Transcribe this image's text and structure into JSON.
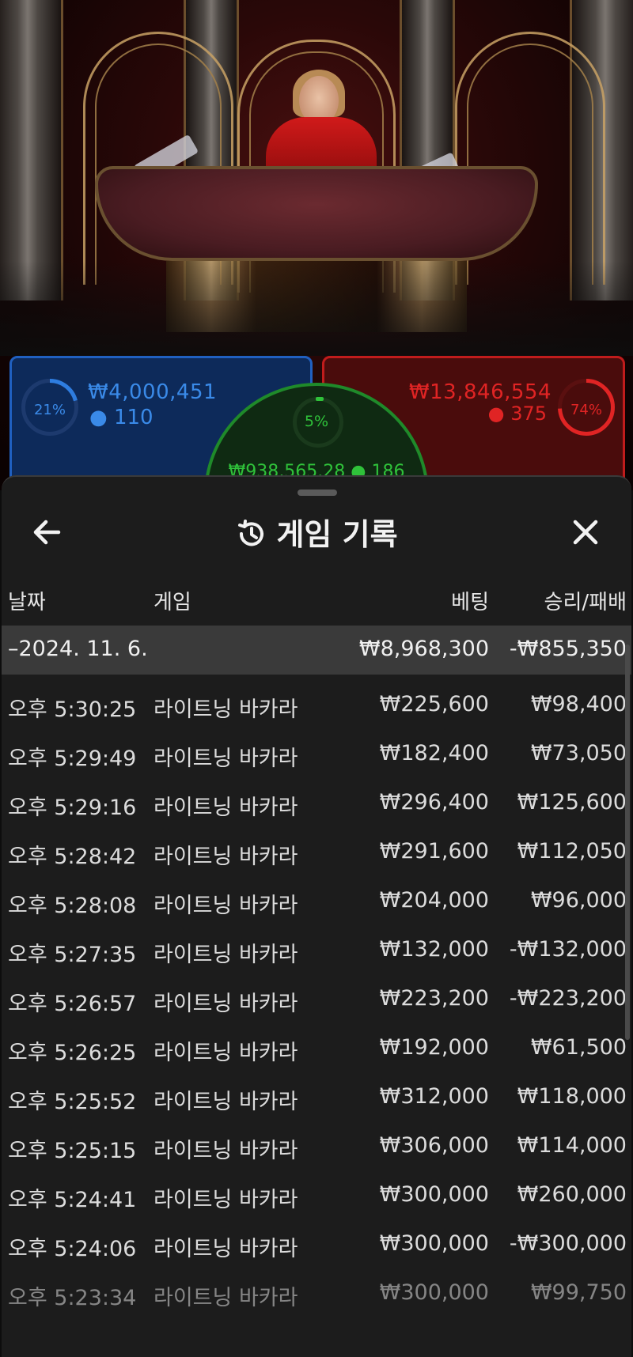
{
  "scene": {
    "player": {
      "percent": "21%",
      "amount": "₩4,000,451",
      "count": "110"
    },
    "banker": {
      "percent": "74%",
      "amount": "₩13,846,554",
      "count": "375"
    },
    "tie": {
      "percent": "5%",
      "amount": "₩938,565.28",
      "count": "186"
    },
    "colors": {
      "player": "#2060c0",
      "banker": "#c01c1c",
      "tie": "#2fc23a"
    }
  },
  "sheet": {
    "title": "게임 기록",
    "icons": {
      "back": "arrow-left-icon",
      "history": "history-icon",
      "close": "close-icon"
    },
    "columns": {
      "date": "날짜",
      "game": "게임",
      "bet": "베팅",
      "win_loss": "승리/패배"
    },
    "summary": {
      "date": "–2024. 11. 6.",
      "bet": "₩8,968,300",
      "win_loss": "-₩855,350"
    },
    "rows": [
      {
        "time": "오후 5:30:25",
        "game": "라이트닝 바카라",
        "bet": "₩225,600",
        "win_loss": "₩98,400"
      },
      {
        "time": "오후 5:29:49",
        "game": "라이트닝 바카라",
        "bet": "₩182,400",
        "win_loss": "₩73,050"
      },
      {
        "time": "오후 5:29:16",
        "game": "라이트닝 바카라",
        "bet": "₩296,400",
        "win_loss": "₩125,600"
      },
      {
        "time": "오후 5:28:42",
        "game": "라이트닝 바카라",
        "bet": "₩291,600",
        "win_loss": "₩112,050"
      },
      {
        "time": "오후 5:28:08",
        "game": "라이트닝 바카라",
        "bet": "₩204,000",
        "win_loss": "₩96,000"
      },
      {
        "time": "오후 5:27:35",
        "game": "라이트닝 바카라",
        "bet": "₩132,000",
        "win_loss": "-₩132,000"
      },
      {
        "time": "오후 5:26:57",
        "game": "라이트닝 바카라",
        "bet": "₩223,200",
        "win_loss": "-₩223,200"
      },
      {
        "time": "오후 5:26:25",
        "game": "라이트닝 바카라",
        "bet": "₩192,000",
        "win_loss": "₩61,500"
      },
      {
        "time": "오후 5:25:52",
        "game": "라이트닝 바카라",
        "bet": "₩312,000",
        "win_loss": "₩118,000"
      },
      {
        "time": "오후 5:25:15",
        "game": "라이트닝 바카라",
        "bet": "₩306,000",
        "win_loss": "₩114,000"
      },
      {
        "time": "오후 5:24:41",
        "game": "라이트닝 바카라",
        "bet": "₩300,000",
        "win_loss": "₩260,000"
      },
      {
        "time": "오후 5:24:06",
        "game": "라이트닝 바카라",
        "bet": "₩300,000",
        "win_loss": "-₩300,000"
      },
      {
        "time": "오후 5:23:34",
        "game": "라이트닝 바카라",
        "bet": "₩300,000",
        "win_loss": "₩99,750"
      }
    ]
  }
}
